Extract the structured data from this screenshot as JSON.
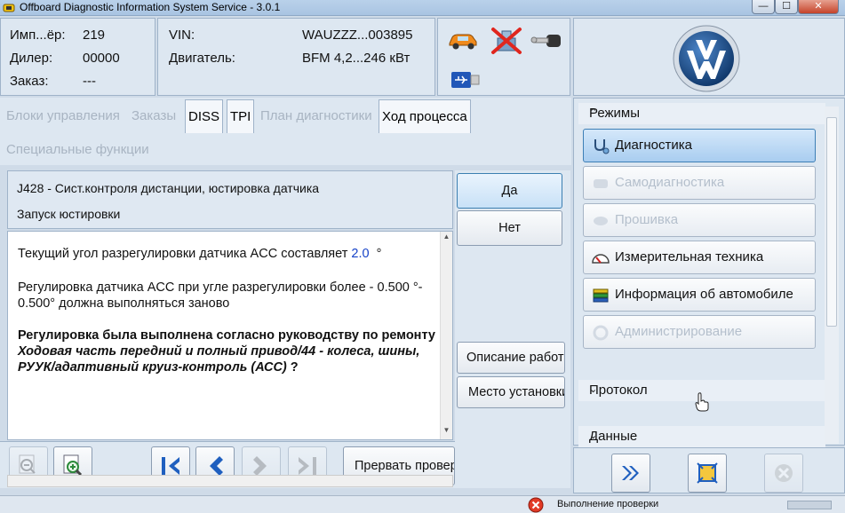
{
  "window": {
    "title": "Offboard Diagnostic Information System Service - 3.0.1",
    "minimize": "—",
    "maximize": "☐",
    "close": "✕"
  },
  "header": {
    "left": [
      {
        "label": "Имп...ёр:",
        "value": "219"
      },
      {
        "label": "Дилер:",
        "value": "00000"
      },
      {
        "label": "Заказ:",
        "value": "---"
      }
    ],
    "vehicle": [
      {
        "label": "VIN:",
        "value": "WAUZZZ...003895"
      },
      {
        "label": "Двигатель:",
        "value": "BFM 4,2...246 кВт"
      }
    ]
  },
  "tabs": [
    {
      "label": "Блоки управления",
      "state": "disabled"
    },
    {
      "label": "Заказы",
      "state": "disabled"
    },
    {
      "label": "DISS",
      "state": "active"
    },
    {
      "label": "TPI",
      "state": "active"
    },
    {
      "label": "План диагностики",
      "state": "disabled"
    },
    {
      "label": "Ход процесса",
      "state": "active"
    },
    {
      "label": "Специальные функции",
      "state": "disabled"
    }
  ],
  "message": {
    "title": "J428 - Сист.контроля дистанции, юстировка датчика",
    "subtitle": "Запуск юстировки"
  },
  "content": {
    "line1_pre": "Текущий угол разрегулировки датчика ACC составляет",
    "line1_value": "2.0",
    "line1_unit": "°",
    "para2": "Регулировка датчика ACC при угле разрегулировки более - 0.500 °- 0.500° должна выполняться заново",
    "para3_bold": "Регулировка была выполнена согласно руководству по ремонту ",
    "para3_bolditalic": "Ходовая часть передний и полный привод/44 - колеса, шины, РУУК/адаптивный круиз-контроль (АСС)",
    "para3_end": " ?"
  },
  "actions": {
    "yes": "Да",
    "no": "Нет",
    "description": "Описание работ",
    "location": "Место установки"
  },
  "toolbar": {
    "abort": "Прервать проверку"
  },
  "right_panel": {
    "modes_title": "Режимы",
    "modes": [
      {
        "label": "Диагностика",
        "state": "active"
      },
      {
        "label": "Самодиагностика",
        "state": "disabled"
      },
      {
        "label": "Прошивка",
        "state": "disabled"
      },
      {
        "label": "Измерительная техника",
        "state": "enabled"
      },
      {
        "label": "Информация об автомобиле",
        "state": "enabled"
      },
      {
        "label": "Администрирование",
        "state": "disabled"
      }
    ],
    "protocol_title": "Протокол",
    "data_title": "Данные"
  },
  "status": {
    "text": "Выполнение проверки"
  },
  "colors": {
    "accent": "#3c7fb1",
    "vw_blue": "#1d4d8a",
    "link_blue": "#1642c8"
  }
}
